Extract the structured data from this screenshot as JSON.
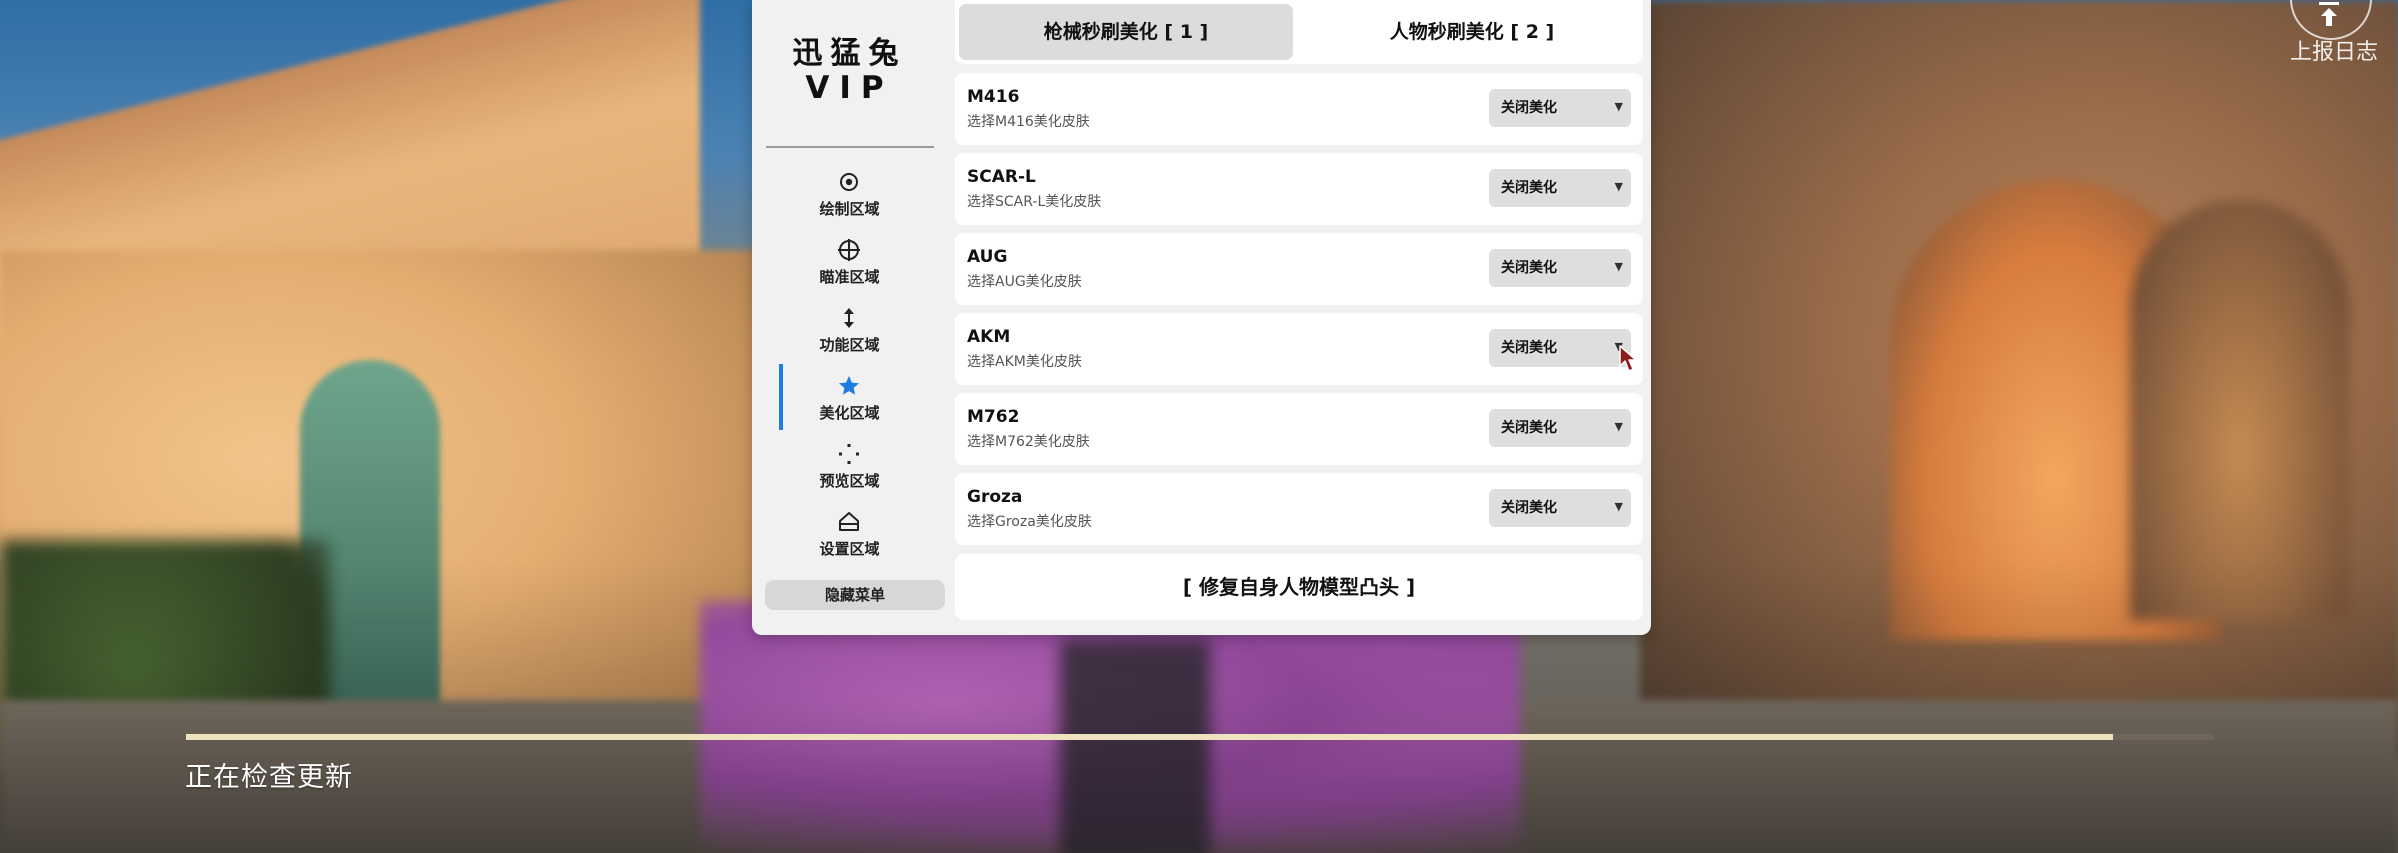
{
  "brand": {
    "line1": "迅猛兔",
    "line2": "VIP"
  },
  "sidebar": {
    "items": [
      {
        "label": "绘制区域",
        "icon": "target-circle-icon"
      },
      {
        "label": "瞄准区域",
        "icon": "crosshair-icon"
      },
      {
        "label": "功能区域",
        "icon": "vertical-arrows-icon"
      },
      {
        "label": "美化区域",
        "icon": "star-icon",
        "active": true
      },
      {
        "label": "预览区域",
        "icon": "dotted-square-icon"
      },
      {
        "label": "设置区域",
        "icon": "home-icon"
      }
    ],
    "hide_menu": "隐藏菜单",
    "accent": "#1e7de0"
  },
  "tabs": [
    {
      "label": "枪械秒刷美化 [ 1 ]",
      "active": true
    },
    {
      "label": "人物秒刷美化 [ 2 ]",
      "active": false
    }
  ],
  "weapons": [
    {
      "name": "M416",
      "desc": "选择M416美化皮肤",
      "value": "关闭美化"
    },
    {
      "name": "SCAR-L",
      "desc": "选择SCAR-L美化皮肤",
      "value": "关闭美化"
    },
    {
      "name": "AUG",
      "desc": "选择AUG美化皮肤",
      "value": "关闭美化"
    },
    {
      "name": "AKM",
      "desc": "选择AKM美化皮肤",
      "value": "关闭美化"
    },
    {
      "name": "M762",
      "desc": "选择M762美化皮肤",
      "value": "关闭美化"
    },
    {
      "name": "Groza",
      "desc": "选择Groza美化皮肤",
      "value": "关闭美化"
    }
  ],
  "fix_button": "[ 修复自身人物模型凸头 ]",
  "report": {
    "label": "上报日志",
    "icon": "upload-icon"
  },
  "status": {
    "text": "正在检查更新",
    "progress": 0.95
  }
}
